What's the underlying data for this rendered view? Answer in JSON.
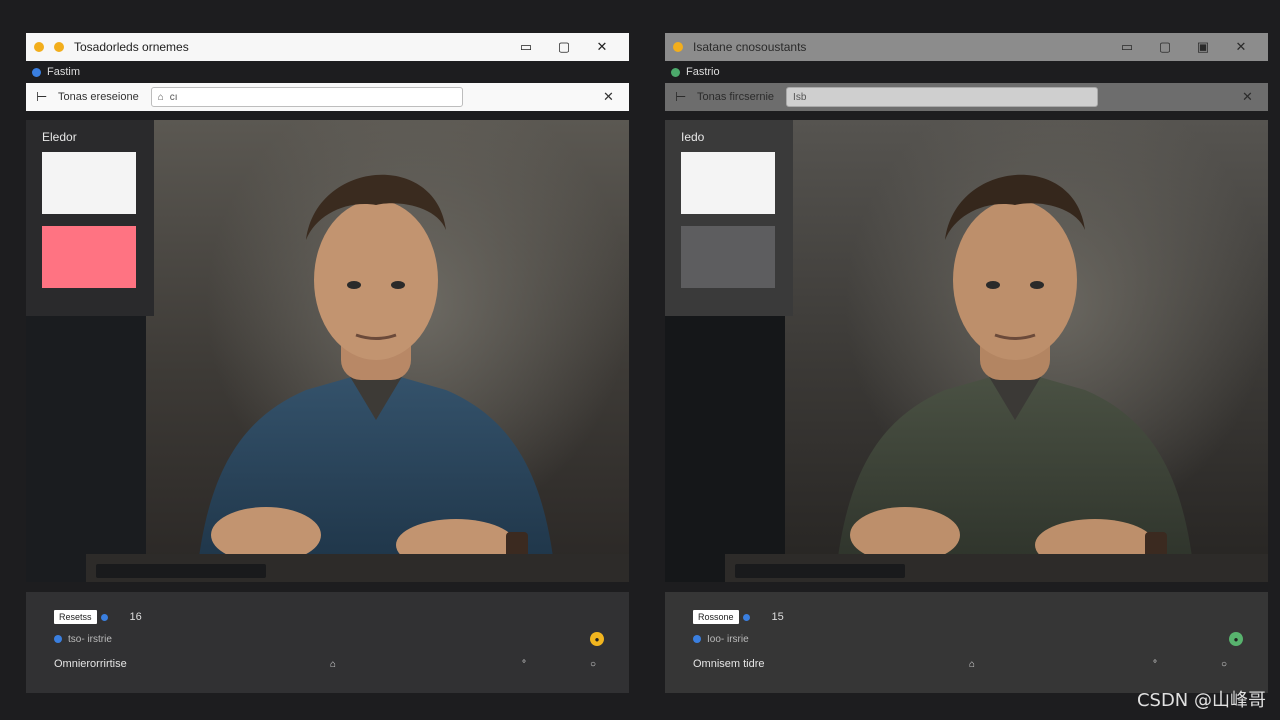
{
  "left": {
    "window": {
      "title": "Tosadorleds ornemes",
      "accent": "#f2ae1c"
    },
    "status": {
      "label": "Fastim",
      "dot_color": "#3a7fe0"
    },
    "toolbar": {
      "back_icon": "back-icon",
      "label": "Tonas  ereseione",
      "address_placeholder": "cı"
    },
    "swatches": {
      "label": "Eledor",
      "top_color": "#f4f4f4",
      "bottom_color": "#ff7382"
    },
    "bottom": {
      "chip": "Resetss",
      "count": "16",
      "sub": "tso- irstrie",
      "row3_label": "Omnierorrirtise",
      "row3_icon_a": "⌂",
      "row3_icon_b": "°",
      "row3_icon_c": "○"
    }
  },
  "right": {
    "window": {
      "title": "Isatane cnosoustants",
      "accent": "#f2ae1c"
    },
    "status": {
      "label": "Fastrio",
      "dot_color": "#4ca96b"
    },
    "toolbar": {
      "back_icon": "back-icon",
      "label": "Tonas  fircsernie",
      "address_placeholder": "Isb"
    },
    "swatches": {
      "label": "Iedo",
      "top_color": "#f4f4f4",
      "bottom_color": "#5d5d5f"
    },
    "bottom": {
      "chip": "Rossone",
      "count": "15",
      "sub": "Ioo- irsrie",
      "row3_label": "Omnisem tidre",
      "row3_icon_a": "⌂",
      "row3_icon_b": "°",
      "row3_icon_c": "○"
    }
  },
  "watermark": "CSDN @山峰哥"
}
